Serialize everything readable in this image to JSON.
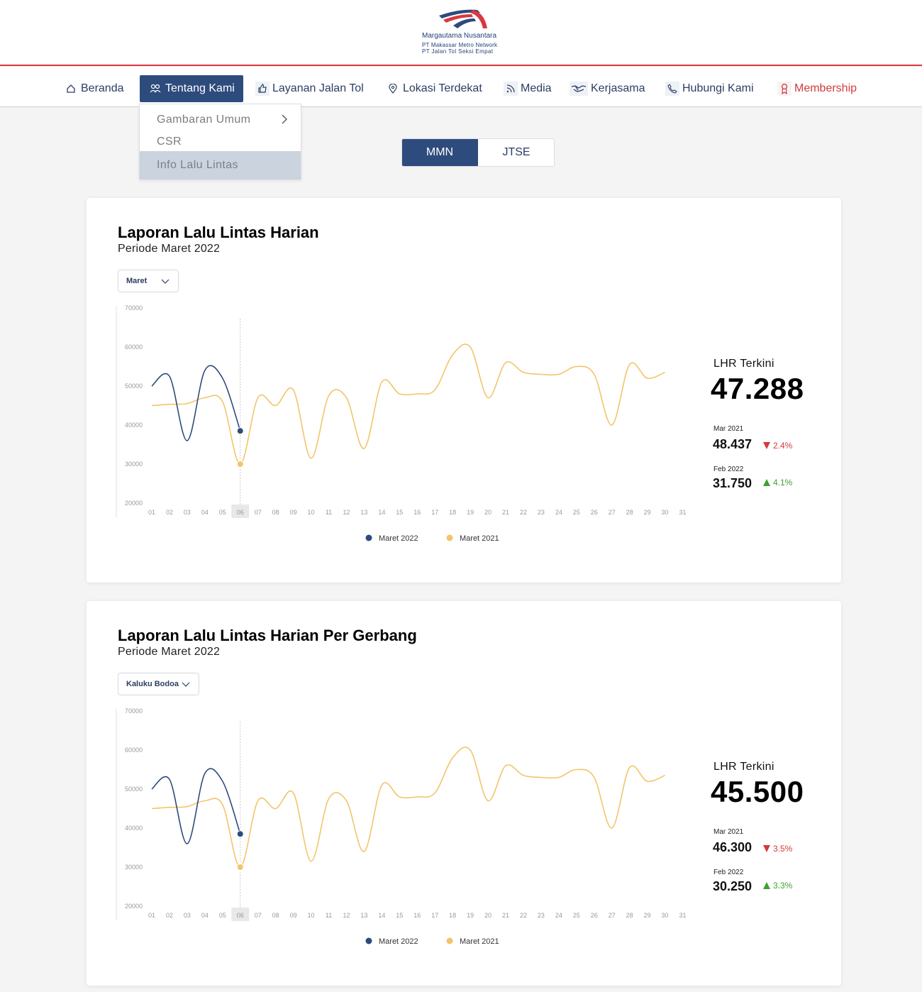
{
  "header": {
    "logo_title": "Margautama Nusantara",
    "logo_line2": "PT Makassar Metro Network",
    "logo_line3": "PT Jalan Tol Seksi Empat"
  },
  "nav": {
    "items": [
      {
        "label": "Beranda",
        "icon": "home-icon"
      },
      {
        "label": "Tentang Kami",
        "icon": "users-icon"
      },
      {
        "label": "Layanan Jalan Tol",
        "icon": "thumbs-up-icon"
      },
      {
        "label": "Lokasi Terdekat",
        "icon": "location-pin-icon"
      },
      {
        "label": "Media",
        "icon": "rss-icon"
      },
      {
        "label": "Kerjasama",
        "icon": "handshake-icon"
      },
      {
        "label": "Hubungi Kami",
        "icon": "phone-icon"
      },
      {
        "label": "Membership",
        "icon": "badge-icon"
      }
    ],
    "active": "Tentang Kami",
    "dropdown": [
      "Gambaran Umum",
      "CSR",
      "Info Lalu Lintas"
    ],
    "dropdown_selected": "Info Lalu Lintas"
  },
  "tabs": [
    "MMN",
    "JTSE"
  ],
  "tab_active": "MMN",
  "colors": {
    "primary": "#2d4b7c",
    "accent_red": "#d33a3a",
    "line_2022": "#2d4b7c",
    "line_2021": "#f3c46a",
    "up": "#3ea12e"
  },
  "cards": [
    {
      "title": "Laporan Lalu Lintas Harian",
      "subtitle": "Periode Maret 2022",
      "select_value": "Maret",
      "lhr_label": "LHR Terkini",
      "lhr_value": "47.288",
      "cmp1_label": "Mar 2021",
      "cmp1_value": "48.437",
      "cmp1_change": "2.4%",
      "cmp1_dir": "down",
      "cmp2_label": "Feb 2022",
      "cmp2_value": "31.750",
      "cmp2_change": "4.1%",
      "cmp2_dir": "up"
    },
    {
      "title": "Laporan Lalu Lintas Harian Per Gerbang",
      "subtitle": "Periode Maret 2022",
      "select_value": "Kaluku Bodoa",
      "lhr_label": "LHR Terkini",
      "lhr_value": "45.500",
      "cmp1_label": "Mar 2021",
      "cmp1_value": "46.300",
      "cmp1_change": "3.5%",
      "cmp1_dir": "down",
      "cmp2_label": "Feb 2022",
      "cmp2_value": "30.250",
      "cmp2_change": "3.3%",
      "cmp2_dir": "up"
    }
  ],
  "chart_data": [
    {
      "type": "line",
      "ylim": [
        20000,
        70000
      ],
      "yticks": [
        "70000",
        "60000",
        "50000",
        "40000",
        "30000",
        "20000"
      ],
      "x": [
        "01",
        "02",
        "03",
        "04",
        "05",
        "06",
        "07",
        "08",
        "09",
        "10",
        "11",
        "12",
        "13",
        "14",
        "15",
        "16",
        "17",
        "18",
        "19",
        "20",
        "21",
        "22",
        "23",
        "24",
        "25",
        "26",
        "27",
        "28",
        "29",
        "30",
        "31"
      ],
      "highlight_x": "06",
      "series": [
        {
          "name": "Maret 2022",
          "values": [
            50000,
            52500,
            36000,
            54000,
            52000,
            38500
          ]
        },
        {
          "name": "Maret 2021",
          "values": [
            45000,
            45300,
            45500,
            47000,
            46000,
            30000,
            47000,
            45000,
            49000,
            31500,
            47500,
            47000,
            34000,
            51000,
            48000,
            48000,
            49000,
            58000,
            60000,
            47000,
            56000,
            53500,
            53000,
            53000,
            55000,
            53000,
            40000,
            55500,
            52000,
            53500
          ]
        }
      ]
    },
    {
      "type": "line",
      "ylim": [
        20000,
        70000
      ],
      "yticks": [
        "70000",
        "60000",
        "50000",
        "40000",
        "30000",
        "20000"
      ],
      "x": [
        "01",
        "02",
        "03",
        "04",
        "05",
        "06",
        "07",
        "08",
        "09",
        "10",
        "11",
        "12",
        "13",
        "14",
        "15",
        "16",
        "17",
        "18",
        "19",
        "20",
        "21",
        "22",
        "23",
        "24",
        "25",
        "26",
        "27",
        "28",
        "29",
        "30",
        "31"
      ],
      "highlight_x": "06",
      "series": [
        {
          "name": "Maret 2022",
          "values": [
            50000,
            52500,
            36000,
            54000,
            52000,
            38500
          ]
        },
        {
          "name": "Maret 2021",
          "values": [
            45000,
            45300,
            45500,
            47000,
            46000,
            30000,
            47000,
            45000,
            49000,
            31500,
            47500,
            47000,
            34000,
            51000,
            48000,
            48000,
            49000,
            58000,
            60000,
            47000,
            56000,
            53500,
            53000,
            53000,
            55000,
            53000,
            40000,
            55500,
            52000,
            53500
          ]
        }
      ]
    }
  ]
}
